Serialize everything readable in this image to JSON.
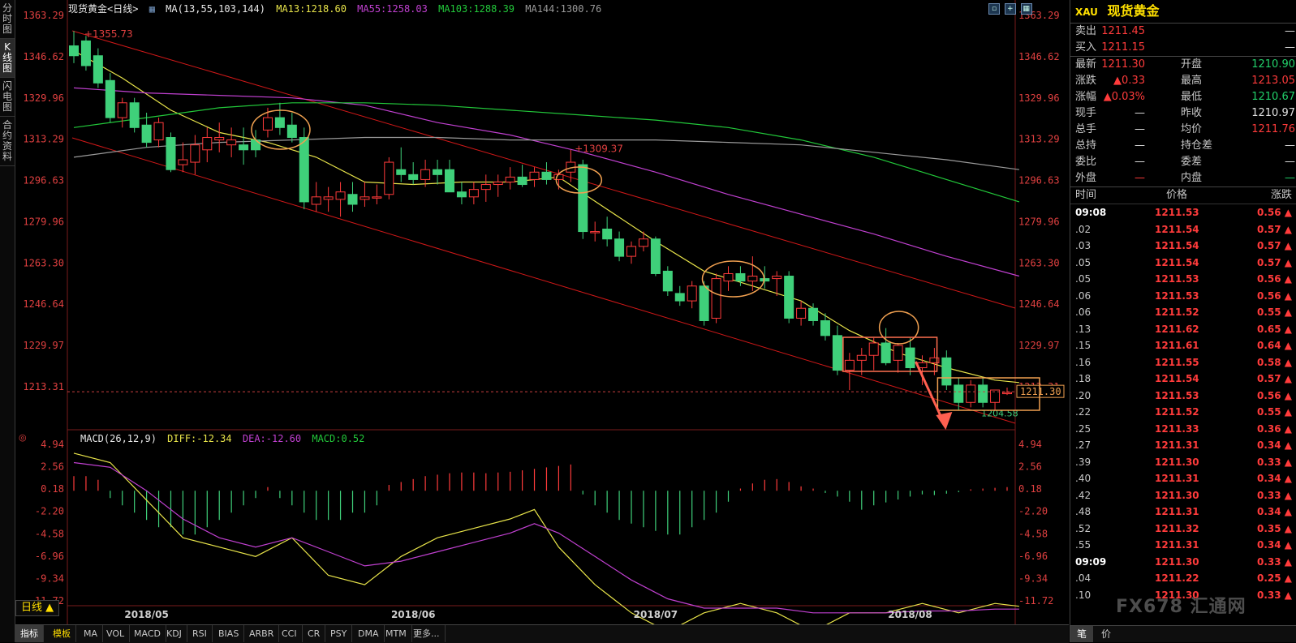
{
  "left_tabs": [
    "分时图",
    "K线图",
    "闪电图",
    "合约资料"
  ],
  "legend": {
    "title": "现货黄金<日线>",
    "ma_label": "MA(13,55,103,144)",
    "ma13": "MA13:1218.60",
    "ma55": "MA55:1258.03",
    "ma103": "MA103:1288.39",
    "ma144": "MA144:1300.76"
  },
  "macd_legend": {
    "label": "MACD(26,12,9)",
    "diff": "DIFF:-12.34",
    "dea": "DEA:-12.60",
    "macd": "MACD:0.52"
  },
  "colors": {
    "up": "#ff3b3b",
    "down": "#3fd07a",
    "ma13": "#e8e44a",
    "ma55": "#c040d0",
    "ma103": "#22c83a",
    "ma144": "#9a9a9a",
    "highlight": "#f0a050",
    "channel": "#d01818"
  },
  "chart_data": {
    "type": "candlestick",
    "title": "现货黄金<日线>",
    "y_labels": [
      "1363.29",
      "1346.62",
      "1329.96",
      "1313.29",
      "1296.63",
      "1279.96",
      "1263.30",
      "1246.64",
      "1229.97",
      "1213.31"
    ],
    "ylim": [
      1202.0,
      1363.29
    ],
    "x_labels": [
      {
        "label": "2018/05",
        "index": 6
      },
      {
        "label": "2018/06",
        "index": 28
      },
      {
        "label": "2018/07",
        "index": 48
      },
      {
        "label": "2018/08",
        "index": 69
      }
    ],
    "current_price": "1211.30",
    "annotations": {
      "high1": "1355.73",
      "high2": "1309.37",
      "low": "1204.58"
    },
    "ohlc": [
      [
        1351,
        1357,
        1344,
        1347
      ],
      [
        1353,
        1355,
        1341,
        1343
      ],
      [
        1347,
        1350,
        1334,
        1336
      ],
      [
        1337,
        1340,
        1320,
        1322
      ],
      [
        1322,
        1330,
        1318,
        1328
      ],
      [
        1328,
        1330,
        1316,
        1318
      ],
      [
        1319,
        1324,
        1310,
        1312
      ],
      [
        1313,
        1322,
        1310,
        1320
      ],
      [
        1314,
        1316,
        1300,
        1301
      ],
      [
        1303,
        1312,
        1300,
        1305
      ],
      [
        1304,
        1315,
        1299,
        1311
      ],
      [
        1309,
        1318,
        1304,
        1314
      ],
      [
        1313,
        1320,
        1308,
        1314
      ],
      [
        1311,
        1318,
        1306,
        1313
      ],
      [
        1311,
        1318,
        1303,
        1309
      ],
      [
        1313,
        1317,
        1306,
        1309
      ],
      [
        1317,
        1326,
        1314,
        1322
      ],
      [
        1322,
        1328,
        1315,
        1318
      ],
      [
        1319,
        1324,
        1312,
        1314
      ],
      [
        1314,
        1318,
        1285,
        1288
      ],
      [
        1287,
        1296,
        1284,
        1290
      ],
      [
        1289,
        1294,
        1284,
        1290
      ],
      [
        1289,
        1296,
        1282,
        1292
      ],
      [
        1291,
        1296,
        1284,
        1287
      ],
      [
        1289,
        1296,
        1286,
        1290
      ],
      [
        1290,
        1295,
        1287,
        1290
      ],
      [
        1291,
        1306,
        1289,
        1304
      ],
      [
        1301,
        1310,
        1296,
        1299
      ],
      [
        1299,
        1304,
        1295,
        1297
      ],
      [
        1297,
        1305,
        1294,
        1301
      ],
      [
        1301,
        1305,
        1295,
        1299
      ],
      [
        1301,
        1305,
        1296,
        1292
      ],
      [
        1292,
        1296,
        1287,
        1290
      ],
      [
        1290,
        1296,
        1287,
        1293
      ],
      [
        1293,
        1299,
        1288,
        1295
      ],
      [
        1295,
        1299,
        1290,
        1296
      ],
      [
        1296,
        1302,
        1293,
        1298
      ],
      [
        1298,
        1303,
        1294,
        1295
      ],
      [
        1297,
        1302,
        1294,
        1300
      ],
      [
        1300,
        1304,
        1295,
        1297
      ],
      [
        1297,
        1301,
        1293,
        1299
      ],
      [
        1300,
        1309,
        1296,
        1304
      ],
      [
        1303,
        1305,
        1273,
        1276
      ],
      [
        1276,
        1280,
        1272,
        1276
      ],
      [
        1277,
        1282,
        1270,
        1273
      ],
      [
        1273,
        1276,
        1264,
        1266
      ],
      [
        1266,
        1272,
        1263,
        1270
      ],
      [
        1270,
        1276,
        1268,
        1273
      ],
      [
        1273,
        1274,
        1258,
        1259
      ],
      [
        1260,
        1262,
        1250,
        1252
      ],
      [
        1251,
        1254,
        1246,
        1248
      ],
      [
        1248,
        1256,
        1245,
        1254
      ],
      [
        1254,
        1256,
        1238,
        1240
      ],
      [
        1241,
        1259,
        1239,
        1257
      ],
      [
        1256,
        1262,
        1252,
        1259
      ],
      [
        1259,
        1262,
        1254,
        1256
      ],
      [
        1256,
        1266,
        1252,
        1258
      ],
      [
        1257,
        1262,
        1253,
        1256
      ],
      [
        1257,
        1260,
        1250,
        1258
      ],
      [
        1258,
        1260,
        1239,
        1241
      ],
      [
        1241,
        1248,
        1238,
        1245
      ],
      [
        1245,
        1247,
        1238,
        1240
      ],
      [
        1240,
        1243,
        1232,
        1234
      ],
      [
        1234,
        1238,
        1218,
        1220
      ],
      [
        1220,
        1227,
        1212,
        1224
      ],
      [
        1224,
        1229,
        1218,
        1226
      ],
      [
        1226,
        1233,
        1220,
        1231
      ],
      [
        1231,
        1237,
        1222,
        1223
      ],
      [
        1224,
        1231,
        1219,
        1230
      ],
      [
        1229,
        1233,
        1218,
        1221
      ],
      [
        1221,
        1226,
        1214,
        1223
      ],
      [
        1223,
        1229,
        1218,
        1225
      ],
      [
        1225,
        1228,
        1212,
        1214
      ],
      [
        1214,
        1217,
        1204,
        1207
      ],
      [
        1207,
        1216,
        1205,
        1214
      ],
      [
        1214,
        1217,
        1205,
        1207
      ],
      [
        1207,
        1212,
        1204,
        1212
      ],
      [
        1211,
        1213,
        1210,
        1211
      ]
    ],
    "ma": {
      "MA13": [
        [
          0,
          1349
        ],
        [
          4,
          1338
        ],
        [
          8,
          1325
        ],
        [
          12,
          1316
        ],
        [
          16,
          1312
        ],
        [
          20,
          1306
        ],
        [
          24,
          1296
        ],
        [
          28,
          1295
        ],
        [
          32,
          1296
        ],
        [
          36,
          1296
        ],
        [
          40,
          1298
        ],
        [
          44,
          1285
        ],
        [
          48,
          1272
        ],
        [
          52,
          1260
        ],
        [
          56,
          1254
        ],
        [
          60,
          1248
        ],
        [
          64,
          1236
        ],
        [
          68,
          1227
        ],
        [
          72,
          1221
        ],
        [
          76,
          1216
        ],
        [
          78,
          1215
        ]
      ],
      "MA55": [
        [
          0,
          1334
        ],
        [
          6,
          1332
        ],
        [
          12,
          1331
        ],
        [
          18,
          1330
        ],
        [
          24,
          1327
        ],
        [
          30,
          1320
        ],
        [
          36,
          1315
        ],
        [
          42,
          1308
        ],
        [
          48,
          1300
        ],
        [
          54,
          1291
        ],
        [
          60,
          1283
        ],
        [
          66,
          1275
        ],
        [
          72,
          1266
        ],
        [
          78,
          1258
        ]
      ],
      "MA103": [
        [
          0,
          1318
        ],
        [
          6,
          1322
        ],
        [
          12,
          1326
        ],
        [
          18,
          1328
        ],
        [
          24,
          1328
        ],
        [
          30,
          1327
        ],
        [
          36,
          1325
        ],
        [
          42,
          1323
        ],
        [
          48,
          1321
        ],
        [
          54,
          1318
        ],
        [
          60,
          1313
        ],
        [
          66,
          1306
        ],
        [
          72,
          1297
        ],
        [
          78,
          1288
        ]
      ],
      "MA144": [
        [
          0,
          1306
        ],
        [
          6,
          1310
        ],
        [
          12,
          1312
        ],
        [
          18,
          1313
        ],
        [
          24,
          1314
        ],
        [
          30,
          1314
        ],
        [
          36,
          1313
        ],
        [
          42,
          1313
        ],
        [
          48,
          1313
        ],
        [
          54,
          1312
        ],
        [
          60,
          1311
        ],
        [
          66,
          1308
        ],
        [
          72,
          1305
        ],
        [
          78,
          1301
        ]
      ]
    },
    "macd": {
      "y_labels": [
        "4.94",
        "2.56",
        "0.18",
        "-2.20",
        "-4.58",
        "-6.96",
        "-9.34",
        "-11.72"
      ],
      "ylim": [
        -15.0,
        5.5
      ],
      "diff": [
        [
          0,
          4
        ],
        [
          3,
          3
        ],
        [
          6,
          -1
        ],
        [
          9,
          -5
        ],
        [
          12,
          -6
        ],
        [
          15,
          -7
        ],
        [
          18,
          -5
        ],
        [
          21,
          -9
        ],
        [
          24,
          -10
        ],
        [
          27,
          -7
        ],
        [
          30,
          -5
        ],
        [
          33,
          -4
        ],
        [
          36,
          -3
        ],
        [
          38,
          -2
        ],
        [
          40,
          -6
        ],
        [
          43,
          -10
        ],
        [
          46,
          -13
        ],
        [
          49,
          -15
        ],
        [
          52,
          -13
        ],
        [
          55,
          -12
        ],
        [
          58,
          -13
        ],
        [
          61,
          -15
        ],
        [
          64,
          -13
        ],
        [
          67,
          -13
        ],
        [
          70,
          -12
        ],
        [
          73,
          -13
        ],
        [
          76,
          -12
        ],
        [
          78,
          -12.3
        ]
      ],
      "dea": [
        [
          0,
          3
        ],
        [
          3,
          2.5
        ],
        [
          6,
          0
        ],
        [
          9,
          -3
        ],
        [
          12,
          -5
        ],
        [
          15,
          -6
        ],
        [
          18,
          -5
        ],
        [
          21,
          -6.5
        ],
        [
          24,
          -8
        ],
        [
          27,
          -7.5
        ],
        [
          30,
          -6.5
        ],
        [
          33,
          -5.5
        ],
        [
          36,
          -4.5
        ],
        [
          38,
          -3.5
        ],
        [
          40,
          -4.5
        ],
        [
          43,
          -7
        ],
        [
          46,
          -9.5
        ],
        [
          49,
          -11.5
        ],
        [
          52,
          -12.5
        ],
        [
          55,
          -12.5
        ],
        [
          58,
          -12.5
        ],
        [
          61,
          -13
        ],
        [
          64,
          -13
        ],
        [
          67,
          -13
        ],
        [
          70,
          -12.8
        ],
        [
          73,
          -12.8
        ],
        [
          76,
          -12.6
        ],
        [
          78,
          -12.6
        ]
      ],
      "hist": [
        2,
        2,
        1.5,
        -1,
        -2,
        -3,
        -4,
        -5,
        -5,
        -6,
        -6,
        -5,
        -4,
        -3,
        -2,
        -1,
        0.5,
        -1,
        -2,
        -3,
        -4,
        -4,
        -4,
        -3,
        -3,
        -2,
        0.8,
        1.2,
        1.6,
        2,
        2.2,
        2.4,
        2.5,
        2.5,
        2.4,
        2.5,
        2.6,
        2.8,
        3,
        3.2,
        3.4,
        3.6,
        -0.5,
        -2,
        -3,
        -4,
        -4.5,
        -5,
        -5.5,
        -6,
        -6,
        -5,
        -4,
        -3,
        -1.5,
        0.3,
        1,
        1.5,
        1.6,
        1.2,
        0.6,
        0.3,
        -0.3,
        -0.8,
        -1.5,
        -2.6,
        -2,
        -1.6,
        -1.2,
        -0.8,
        -0.5,
        -0.6,
        -0.4,
        -0.2,
        0.2,
        0.3,
        0.4,
        0.5
      ]
    }
  },
  "period_badge": "日线 ▲",
  "bottom_tabs": [
    "指标",
    "模板",
    "MA",
    "VOL",
    "MACD",
    "KDJ",
    "RSI",
    "BIAS",
    "ARBR",
    "CCI",
    "CR",
    "PSY",
    "DMA",
    "MTM",
    "更多..."
  ],
  "quote": {
    "code": "XAU",
    "name": "现货黄金",
    "rows": [
      {
        "l": "卖出",
        "v": "1211.45",
        "vc": "red",
        "l2": "",
        "v2": "—",
        "v2c": "white"
      },
      {
        "l": "买入",
        "v": "1211.15",
        "vc": "red",
        "l2": "",
        "v2": "—",
        "v2c": "white"
      },
      {
        "l": "最新",
        "v": "1211.30",
        "vc": "red",
        "l2": "开盘",
        "v2": "1210.90",
        "v2c": "green"
      },
      {
        "l": "涨跌",
        "v": "▲0.33",
        "vc": "red",
        "l2": "最高",
        "v2": "1213.05",
        "v2c": "red"
      },
      {
        "l": "涨幅",
        "v": "▲0.03%",
        "vc": "red",
        "l2": "最低",
        "v2": "1210.67",
        "v2c": "green"
      },
      {
        "l": "现手",
        "v": "—",
        "vc": "white",
        "l2": "昨收",
        "v2": "1210.97",
        "v2c": "white"
      },
      {
        "l": "总手",
        "v": "—",
        "vc": "white",
        "l2": "均价",
        "v2": "1211.76",
        "v2c": "red"
      },
      {
        "l": "总持",
        "v": "—",
        "vc": "white",
        "l2": "持仓差",
        "v2": "—",
        "v2c": "white"
      },
      {
        "l": "委比",
        "v": "—",
        "vc": "white",
        "l2": "委差",
        "v2": "—",
        "v2c": "white"
      },
      {
        "l": "外盘",
        "v": "—",
        "vc": "red",
        "l2": "内盘",
        "v2": "—",
        "v2c": "green"
      }
    ]
  },
  "ticks": {
    "head": {
      "time": "时间",
      "price": "价格",
      "change": "涨跌"
    },
    "rows": [
      {
        "t": "09:08",
        "p": "1211.53",
        "c": "0.56"
      },
      {
        "t": ".02",
        "p": "1211.54",
        "c": "0.57"
      },
      {
        "t": ".03",
        "p": "1211.54",
        "c": "0.57"
      },
      {
        "t": ".05",
        "p": "1211.54",
        "c": "0.57"
      },
      {
        "t": ".05",
        "p": "1211.53",
        "c": "0.56"
      },
      {
        "t": ".06",
        "p": "1211.53",
        "c": "0.56"
      },
      {
        "t": ".06",
        "p": "1211.52",
        "c": "0.55"
      },
      {
        "t": ".13",
        "p": "1211.62",
        "c": "0.65"
      },
      {
        "t": ".15",
        "p": "1211.61",
        "c": "0.64"
      },
      {
        "t": ".16",
        "p": "1211.55",
        "c": "0.58"
      },
      {
        "t": ".18",
        "p": "1211.54",
        "c": "0.57"
      },
      {
        "t": ".20",
        "p": "1211.53",
        "c": "0.56"
      },
      {
        "t": ".22",
        "p": "1211.52",
        "c": "0.55"
      },
      {
        "t": ".25",
        "p": "1211.33",
        "c": "0.36"
      },
      {
        "t": ".27",
        "p": "1211.31",
        "c": "0.34"
      },
      {
        "t": ".39",
        "p": "1211.30",
        "c": "0.33"
      },
      {
        "t": ".40",
        "p": "1211.31",
        "c": "0.34"
      },
      {
        "t": ".42",
        "p": "1211.30",
        "c": "0.33"
      },
      {
        "t": ".48",
        "p": "1211.31",
        "c": "0.34"
      },
      {
        "t": ".52",
        "p": "1211.32",
        "c": "0.35"
      },
      {
        "t": ".55",
        "p": "1211.31",
        "c": "0.34"
      },
      {
        "t": "09:09",
        "p": "1211.30",
        "c": "0.33"
      },
      {
        "t": ".04",
        "p": "1211.22",
        "c": "0.25"
      },
      {
        "t": ".10",
        "p": "1211.30",
        "c": "0.33"
      }
    ]
  },
  "foot_tabs": [
    "笔",
    "价"
  ],
  "watermark": "FX678 汇通网"
}
